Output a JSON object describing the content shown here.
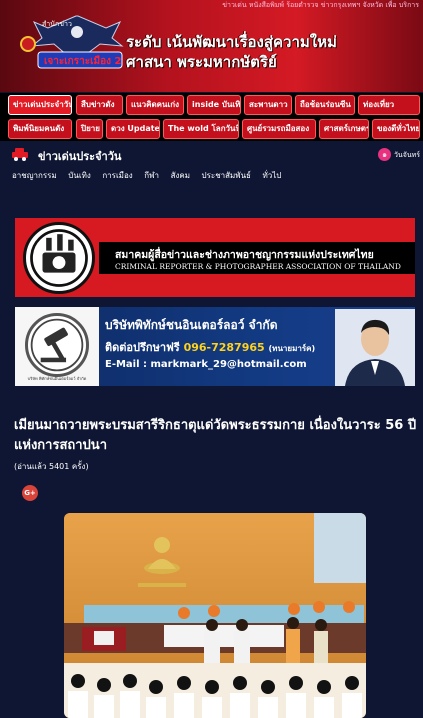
{
  "header": {
    "ticker": "ข่าวเด่น หนังสือพิมพ์ ร้อยตำรวจ ข่าวกรุงเทพฯ จังหวัด เพื่อ บริการ",
    "logo_small": "สำนักข่าว",
    "logo_text": "เจาะเกราะเมือง 2",
    "slogan_line1": "ระดับ เน้นพัฒนาเรื่องสู่ความใหม่",
    "slogan_line2": "ศาสนา พระมหากษัตริย์"
  },
  "categories": [
    {
      "label": "ข่าวเด่นประจำวัน",
      "active": true
    },
    {
      "label": "สืบข่าวดัง"
    },
    {
      "label": "แนวคิดคนเก่ง"
    },
    {
      "label": "inside บันเทิง"
    },
    {
      "label": "สะพานดาว"
    },
    {
      "label": "ถือช้อนร่อนซีน"
    },
    {
      "label": "ท่องเที่ยว"
    },
    {
      "label": "พิมพ์นิยมคนดัง"
    },
    {
      "label": "ปิยาย"
    },
    {
      "label": "ดวง Update"
    },
    {
      "label": "The wold โลกวันนี้"
    },
    {
      "label": "ศูนย์รวมรถมือสอง"
    },
    {
      "label": "ศาสตร์เกษตร"
    },
    {
      "label": "ของดีทั่วไทย"
    }
  ],
  "section": {
    "title": "ข่าวเด่นประจำวัน",
    "date_badge": "๑",
    "date": "วันจันทร์"
  },
  "subnav": [
    "อาชญากรรม",
    "บันเทิง",
    "การเมือง",
    "กีฬา",
    "สังคม",
    "ประชาสัมพันธ์",
    "ทั่วไป"
  ],
  "ads": {
    "association_th": "สมาคมผู้สื่อข่าวและช่างภาพอาชญากรรมแห่งประเทศไทย",
    "association_en": "CRIMINAL REPORTER & PHOTOGRAPHER ASSOCIATION OF THAILAND",
    "law_company": "บริษัทพิทักษ์ชนอินเตอร์ลอว์ จำกัด",
    "law_tel_label": "ติดต่อปรึกษาฟรี",
    "law_tel_number": "096-7287965",
    "law_tel_name": "(ทนายมาร์ค)",
    "law_email": "E-Mail : markmark_29@hotmail.com",
    "law_logo_caption": "บริษัท พิทักษ์ชนอินเตอร์ลอว์ จำกัด"
  },
  "article": {
    "headline": "เมียนมาถวายพระบรมสารีริกธาตุแด่วัดพระธรรมกาย เนื่องในวาระ 56 ปีแห่งการสถาปนา",
    "views": "(อ่านแล้ว 5401 ครั้ง)",
    "share_label": "G+"
  },
  "colors": {
    "page_bg": "#0f1633",
    "accent_red": "#c4101c",
    "banner_red": "#d41a24",
    "highlight_yellow": "#ffd21e"
  }
}
